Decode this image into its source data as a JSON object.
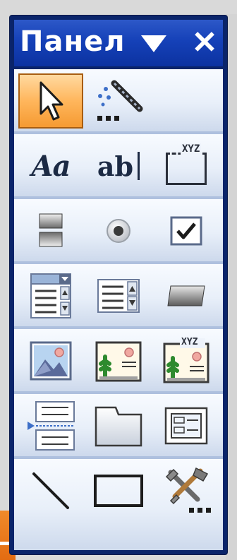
{
  "window": {
    "title": "Панел",
    "dropdown_glyph": "▼",
    "close_glyph": "✕"
  },
  "tools": [
    [
      {
        "name": "select-objects",
        "icon": "pointer-icon",
        "selected": true
      },
      {
        "name": "control-wizards",
        "icon": "magic-wand-icon",
        "selected": false
      }
    ],
    [
      {
        "name": "label",
        "icon": "label-icon",
        "text": "Aa"
      },
      {
        "name": "text-box",
        "icon": "textbox-icon",
        "text": "ab"
      },
      {
        "name": "option-group",
        "icon": "option-group-icon",
        "text": "XYZ"
      }
    ],
    [
      {
        "name": "toggle-button",
        "icon": "toggle-button-icon"
      },
      {
        "name": "option-button",
        "icon": "radio-button-icon"
      },
      {
        "name": "check-box",
        "icon": "checkbox-icon"
      }
    ],
    [
      {
        "name": "combo-box",
        "icon": "combo-box-icon"
      },
      {
        "name": "list-box",
        "icon": "list-box-icon"
      },
      {
        "name": "command-button",
        "icon": "command-button-icon"
      }
    ],
    [
      {
        "name": "image",
        "icon": "image-icon"
      },
      {
        "name": "unbound-object-frame",
        "icon": "unbound-object-icon"
      },
      {
        "name": "bound-object-frame",
        "icon": "bound-object-icon",
        "text": "XYZ"
      }
    ],
    [
      {
        "name": "page-break",
        "icon": "page-break-icon"
      },
      {
        "name": "tab-control",
        "icon": "tab-control-icon"
      },
      {
        "name": "subform",
        "icon": "subform-icon"
      }
    ],
    [
      {
        "name": "line",
        "icon": "line-icon"
      },
      {
        "name": "rectangle",
        "icon": "rectangle-icon"
      },
      {
        "name": "more-controls",
        "icon": "tools-icon"
      }
    ]
  ],
  "colors": {
    "titlebar": "#1541b8",
    "selected": "#ffb65c",
    "panel": "#eef3fb"
  }
}
